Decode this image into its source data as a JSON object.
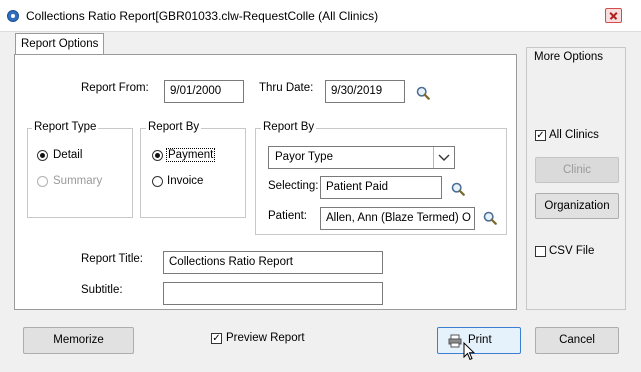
{
  "window": {
    "title": "Collections Ratio Report[GBR01033.clw-RequestColle (All Clinics)"
  },
  "tabs": [
    {
      "label": "Report Options"
    }
  ],
  "dates": {
    "from_label": "Report From:",
    "from_value": "9/01/2000",
    "thru_label": "Thru Date:",
    "thru_value": "9/30/2019"
  },
  "report_type": {
    "title": "Report Type",
    "options": [
      {
        "label": "Detail",
        "selected": true,
        "enabled": true
      },
      {
        "label": "Summary",
        "selected": false,
        "enabled": false
      }
    ]
  },
  "report_by_left": {
    "title": "Report By",
    "options": [
      {
        "label": "Payment",
        "selected": true
      },
      {
        "label": "Invoice",
        "selected": false
      }
    ]
  },
  "report_by_right": {
    "title": "Report By",
    "select_value": "Payor Type",
    "selecting_label": "Selecting:",
    "selecting_value": "Patient Paid",
    "patient_label": "Patient:",
    "patient_value": "Allen, Ann (Blaze Termed) O"
  },
  "titles": {
    "report_title_label": "Report Title:",
    "report_title_value": "Collections Ratio Report",
    "subtitle_label": "Subtitle:",
    "subtitle_value": ""
  },
  "more_options": {
    "title": "More Options",
    "all_clinics_label": "All Clinics",
    "all_clinics_checked": true,
    "clinic_button": "Clinic",
    "organization_button": "Organization",
    "csv_label": "CSV File",
    "csv_checked": false
  },
  "footer": {
    "memorize_button": "Memorize",
    "preview_label": "Preview Report",
    "preview_checked": true,
    "print_button": "Print",
    "cancel_button": "Cancel"
  },
  "colors": {
    "accent": "#3c7fd0",
    "titlebar_icon": "#2f6fc0"
  }
}
